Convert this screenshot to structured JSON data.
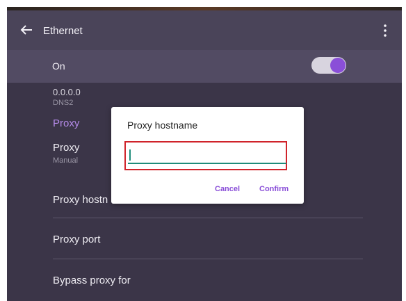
{
  "appbar": {
    "title": "Ethernet"
  },
  "switch": {
    "label": "On",
    "state": "on",
    "accent_color": "#8a4fd8"
  },
  "settings": {
    "dns_value": "0.0.0.0",
    "dns_label": "DNS2",
    "section_title": "Proxy",
    "proxy_title": "Proxy",
    "proxy_value": "Manual",
    "proxy_hostname": "Proxy hostn",
    "proxy_port": "Proxy port",
    "bypass_proxy": "Bypass proxy for"
  },
  "dialog": {
    "title": "Proxy hostname",
    "input_value": "",
    "cancel_label": "Cancel",
    "confirm_label": "Confirm",
    "highlight_color": "#d0232a"
  },
  "icons": {
    "back": "back-arrow-icon",
    "menu": "more-vert-icon"
  }
}
